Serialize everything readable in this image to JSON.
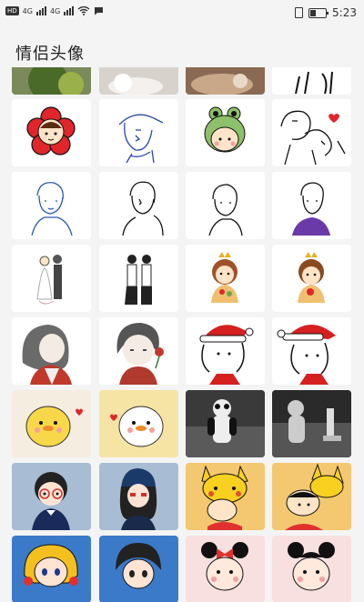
{
  "status_bar": {
    "hd_label": "HD",
    "net_label_1": "4G",
    "net_label_2": "4G",
    "time": "5:23"
  },
  "page": {
    "title": "情侣头像"
  },
  "tiles": [
    {
      "name": "avatar-couple-top-1"
    },
    {
      "name": "avatar-couple-top-2"
    },
    {
      "name": "avatar-couple-top-3"
    },
    {
      "name": "avatar-couple-top-4"
    },
    {
      "name": "avatar-red-flower-girl"
    },
    {
      "name": "avatar-sketch-boy-cap"
    },
    {
      "name": "avatar-frog-hat-kid"
    },
    {
      "name": "avatar-sketch-couple-hug"
    },
    {
      "name": "avatar-blue-sketch-boy"
    },
    {
      "name": "avatar-sketch-profile"
    },
    {
      "name": "avatar-sketch-small-boy"
    },
    {
      "name": "avatar-purple-shirt-boy"
    },
    {
      "name": "avatar-wedding-couple"
    },
    {
      "name": "avatar-couple-standing"
    },
    {
      "name": "avatar-crown-girl"
    },
    {
      "name": "avatar-crown-boy"
    },
    {
      "name": "avatar-grey-hair-girl"
    },
    {
      "name": "avatar-boy-with-rose"
    },
    {
      "name": "avatar-santa-hat-girl"
    },
    {
      "name": "avatar-santa-hat-girl-2"
    },
    {
      "name": "avatar-yellow-chick"
    },
    {
      "name": "avatar-white-chick"
    },
    {
      "name": "avatar-panda-costume"
    },
    {
      "name": "avatar-grey-costume"
    },
    {
      "name": "avatar-glasses-boy"
    },
    {
      "name": "avatar-beanie-girl"
    },
    {
      "name": "avatar-pikachu-shinchan"
    },
    {
      "name": "avatar-pikachu-shinchan-2"
    },
    {
      "name": "avatar-blonde-girl"
    },
    {
      "name": "avatar-dark-hair-boy"
    },
    {
      "name": "avatar-minnie-girl"
    },
    {
      "name": "avatar-mickey-girl"
    }
  ]
}
